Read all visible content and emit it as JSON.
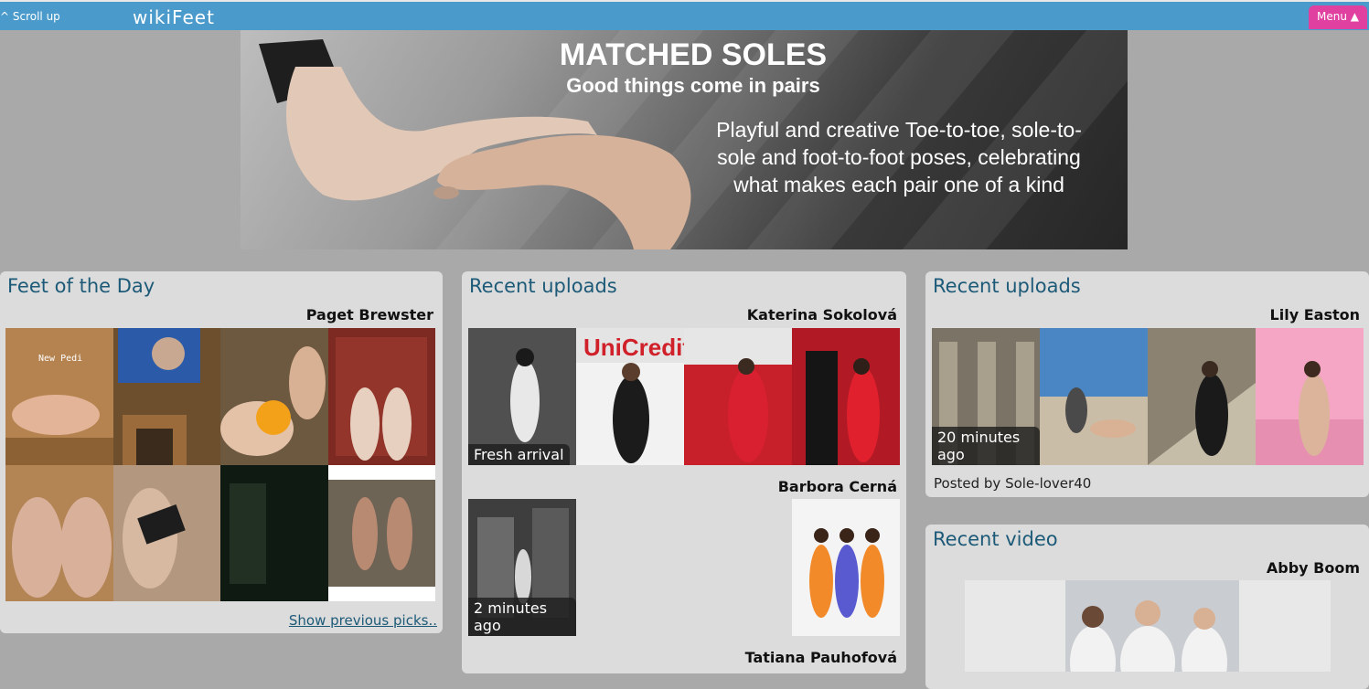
{
  "topbar": {
    "scroll_up": "^ Scroll up",
    "logo": "wikiFeet",
    "menu": "Menu ▲"
  },
  "banner": {
    "title": "MATCHED SOLES",
    "subtitle": "Good things come in pairs",
    "description": "Playful and creative Toe-to-toe, sole-to-sole and foot-to-foot poses, celebrating what makes each pair one of a kind"
  },
  "feet_of_day": {
    "title": "Feet of the Day",
    "name": "Paget Brewster",
    "photo_caption": "New Pedi",
    "show_previous": "Show previous picks.."
  },
  "recent_uploads_1": {
    "title": "Recent uploads",
    "entries": [
      {
        "name": "Katerina Sokolová",
        "badge": "Fresh arrival"
      },
      {
        "name": "Barbora Cerná",
        "badge": "2 minutes ago"
      },
      {
        "name": "Tatiana Pauhofová"
      }
    ],
    "sign_text": "UniCredit"
  },
  "recent_uploads_2": {
    "title": "Recent uploads",
    "name": "Lily Easton",
    "badge": "20 minutes ago",
    "posted_by": "Posted by Sole-lover40"
  },
  "recent_video": {
    "title": "Recent video",
    "name": "Abby Boom"
  }
}
